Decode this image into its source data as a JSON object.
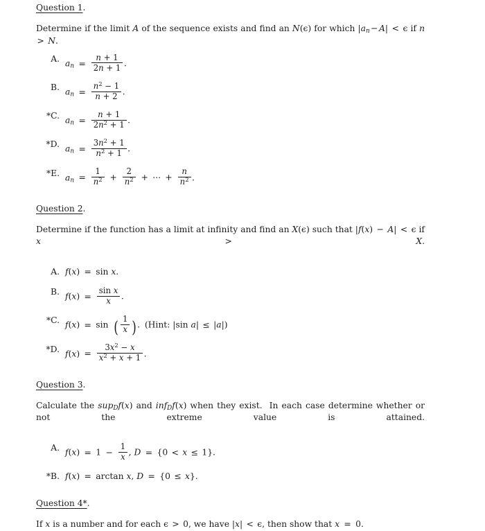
{
  "document": {
    "type": "math-problem-set",
    "questions": [
      {
        "id": "q1",
        "heading_underlined": "Question 1",
        "heading_suffix": ".",
        "prompt_segments": [
          "Determine if the limit ",
          "A",
          " of the sequence exists and find an ",
          "N(ϵ)",
          " for which ",
          "|a",
          "n",
          " − A| < ϵ",
          " if ",
          "n > N",
          "."
        ],
        "prompt_plain": "Determine if the limit A of the sequence exists and find an N(ϵ) for which |a_n − A| < ϵ if n > N.",
        "items": [
          {
            "label": "A.",
            "starred": false,
            "lhs": "a_n",
            "formula": "(n + 1) / (2n + 1)",
            "numerator": "n + 1",
            "denominator": "2n + 1",
            "trailing": "."
          },
          {
            "label": "B.",
            "starred": false,
            "lhs": "a_n",
            "formula": "(n² − 1) / (n + 2)",
            "numerator": "n² − 1",
            "denominator": "n + 2",
            "trailing": "."
          },
          {
            "label": "C.",
            "starred": true,
            "lhs": "a_n",
            "formula": "(n + 1) / (2n² + 1)",
            "numerator": "n + 1",
            "denominator": "2n² + 1",
            "trailing": "."
          },
          {
            "label": "D.",
            "starred": true,
            "lhs": "a_n",
            "formula": "(3n² + 1) / (n² + 1)",
            "numerator": "3n² + 1",
            "denominator": "n² + 1",
            "trailing": "."
          },
          {
            "label": "E.",
            "starred": true,
            "lhs": "a_n",
            "formula": "1/n² + 2/n² + ··· + n/n²",
            "trailing": "."
          }
        ]
      },
      {
        "id": "q2",
        "heading_underlined": "Question 2",
        "heading_suffix": ".",
        "prompt_line1": "Determine if the function has a limit at infinity and find an X(ϵ) such that |f(x) − A| < ϵ if",
        "prompt_line2": "x > X.",
        "prompt_plain": "Determine if the function has a limit at infinity and find an X(ϵ) such that |f(x) − A| < ϵ if x > X.",
        "items": [
          {
            "label": "A.",
            "starred": false,
            "lhs": "f(x)",
            "formula": "sin x",
            "trailing": "."
          },
          {
            "label": "B.",
            "starred": false,
            "lhs": "f(x)",
            "formula": "(sin x) / x",
            "numerator": "sin x",
            "denominator": "x",
            "trailing": "."
          },
          {
            "label": "C.",
            "starred": true,
            "lhs": "f(x)",
            "formula": "sin (1/x)",
            "numerator": "1",
            "denominator": "x",
            "trailing": ".",
            "hint": "(Hint: |sin a| ≤ |a|)"
          },
          {
            "label": "D.",
            "starred": true,
            "lhs": "f(x)",
            "formula": "(3x² − x) / (x² + x + 1)",
            "numerator": "3x² − x",
            "denominator": "x² + x + 1",
            "trailing": "."
          }
        ]
      },
      {
        "id": "q3",
        "heading_underlined": "Question 3",
        "heading_suffix": ".",
        "prompt_line1": "Calculate the sup_D f(x) and inf_D f(x) when they exist.  In each case determine whether or not the",
        "prompt_line2": "extreme value is attained.",
        "prompt_plain": "Calculate the sup_D f(x) and inf_D f(x) when they exist. In each case determine whether or not the extreme value is attained.",
        "items": [
          {
            "label": "A.",
            "starred": false,
            "lhs": "f(x)",
            "formula": "1 − 1/x,  D = {0 < x ≤ 1}",
            "numerator": "1",
            "denominator": "x",
            "domain": "D = {0 < x ≤ 1}",
            "trailing": "."
          },
          {
            "label": "B.",
            "starred": true,
            "lhs": "f(x)",
            "formula": "arctan x,  D = {0 ≤ x}",
            "domain": "D = {0 ≤ x}",
            "trailing": "."
          }
        ]
      },
      {
        "id": "q4",
        "heading_underlined": "Question 4*",
        "heading_suffix": ".",
        "prompt_plain": "If x is a number and for each ϵ > 0, we have |x| < ϵ, then show that x = 0.",
        "items": []
      }
    ]
  }
}
